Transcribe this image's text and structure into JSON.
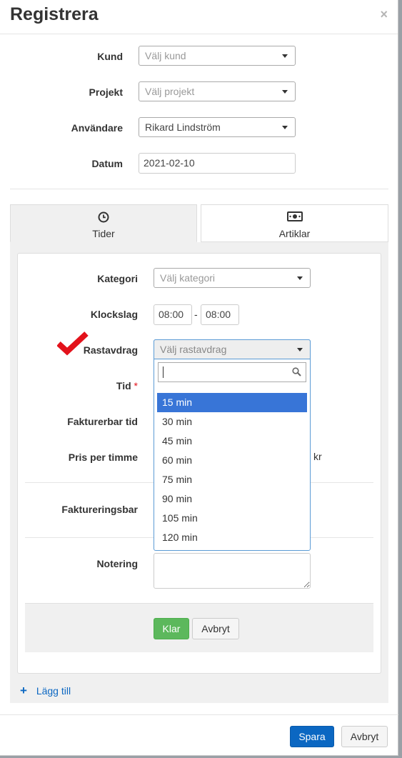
{
  "modal": {
    "title": "Registrera",
    "close": "×"
  },
  "form": {
    "kund": {
      "label": "Kund",
      "placeholder": "Välj kund"
    },
    "projekt": {
      "label": "Projekt",
      "placeholder": "Välj projekt"
    },
    "anvandare": {
      "label": "Användare",
      "value": "Rikard Lindström"
    },
    "datum": {
      "label": "Datum",
      "value": "2021-02-10"
    }
  },
  "tabs": [
    {
      "label": "Tider",
      "icon": "clock-icon",
      "active": true
    },
    {
      "label": "Artiklar",
      "icon": "banknote-icon",
      "active": false
    }
  ],
  "tider": {
    "kategori": {
      "label": "Kategori",
      "placeholder": "Välj kategori"
    },
    "klockslag": {
      "label": "Klockslag",
      "from": "08:00",
      "separator": "-",
      "to": "08:00"
    },
    "rastavdrag": {
      "label": "Rastavdrag",
      "placeholder": "Välj rastavdrag",
      "options": [
        "15 min",
        "30 min",
        "45 min",
        "60 min",
        "75 min",
        "90 min",
        "105 min",
        "120 min"
      ],
      "highlighted": "15 min"
    },
    "tid": {
      "label": "Tid",
      "required": "*"
    },
    "fakturerbar_tid": {
      "label": "Fakturerbar tid"
    },
    "pris_per_timme": {
      "label": "Pris per timme",
      "unit": "kr"
    },
    "faktureringsbar": {
      "label": "Faktureringsbar"
    },
    "notering": {
      "label": "Notering"
    },
    "klar_button": "Klar",
    "avbryt_button": "Avbryt",
    "add_link": "Lägg till"
  },
  "footer": {
    "save": "Spara",
    "cancel": "Avbryt"
  },
  "colors": {
    "primary": "#0b67c2",
    "success": "#5cb85c",
    "highlight": "#3875d7",
    "check": "#e3121b",
    "required": "#e3121b"
  }
}
